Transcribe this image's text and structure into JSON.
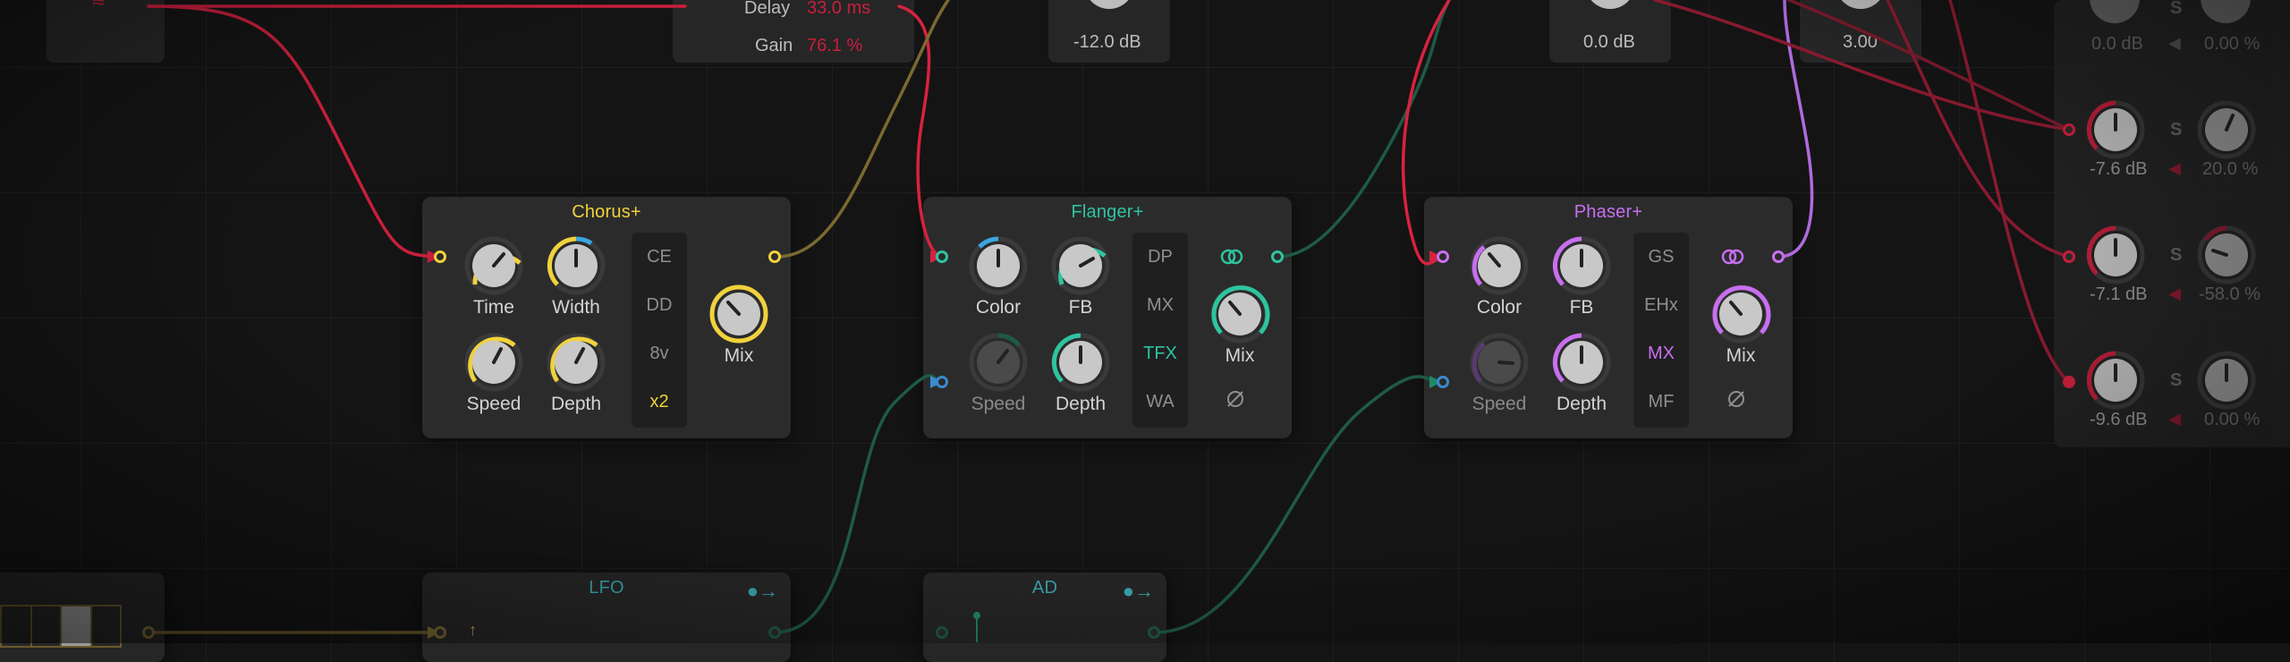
{
  "colors": {
    "chorus": "#f0d23c",
    "flanger": "#2ec4a0",
    "phaser": "#c86ff0",
    "red": "#d02040",
    "teal_cable": "#1f5a46",
    "lfo_title": "#3aa6b0"
  },
  "top_strip": {
    "delay_label": "Delay",
    "delay_value": "33.0 ms",
    "gain_label": "Gain",
    "gain_value": "76.1 %",
    "level1": "-12.0 dB",
    "level2": "0.0 dB",
    "level3": "3.00"
  },
  "chorus": {
    "title": "Chorus+",
    "knobs": {
      "time": "Time",
      "width": "Width",
      "speed": "Speed",
      "depth": "Depth",
      "mix": "Mix"
    },
    "modes": [
      "CE",
      "DD",
      "8v",
      "x2"
    ],
    "active_mode": "x2"
  },
  "flanger": {
    "title": "Flanger+",
    "knobs": {
      "color": "Color",
      "fb": "FB",
      "speed": "Speed",
      "depth": "Depth",
      "mix": "Mix"
    },
    "modes": [
      "DP",
      "MX",
      "TFX",
      "WA"
    ],
    "active_mode": "TFX",
    "phase_icon": "phase-invert-icon",
    "stereo_icon": "stereo-link-icon"
  },
  "phaser": {
    "title": "Phaser+",
    "knobs": {
      "color": "Color",
      "fb": "FB",
      "speed": "Speed",
      "depth": "Depth",
      "mix": "Mix"
    },
    "modes": [
      "GS",
      "EHx",
      "MX",
      "MF"
    ],
    "active_mode": "MX",
    "phase_icon": "phase-invert-icon",
    "stereo_icon": "stereo-link-icon"
  },
  "lfo": {
    "title": "LFO"
  },
  "ad": {
    "title": "AD"
  },
  "mixer": {
    "rows": [
      {
        "level": "0.0 dB",
        "solo": "S",
        "pan": "0.00 %"
      },
      {
        "level": "-7.6 dB",
        "solo": "S",
        "pan": "20.0 %"
      },
      {
        "level": "-7.1 dB",
        "solo": "S",
        "pan": "-58.0 %"
      },
      {
        "level": "-9.6 dB",
        "solo": "S",
        "pan": "0.00 %"
      }
    ]
  }
}
